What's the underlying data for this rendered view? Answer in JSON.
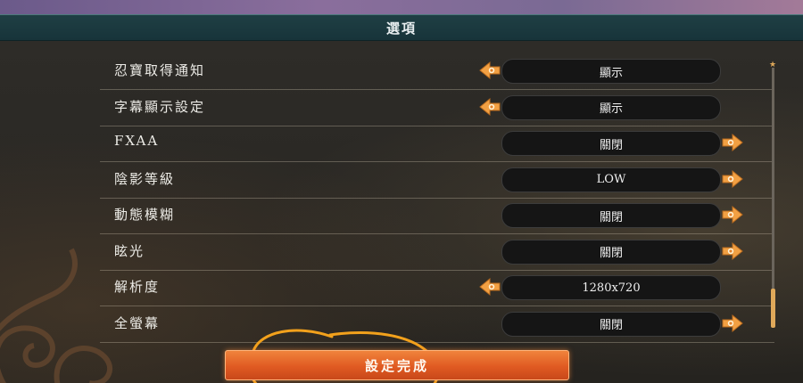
{
  "header": {
    "title": "選項"
  },
  "settings": [
    {
      "label": "忍寶取得通知",
      "value": "顯示",
      "arrow": "left"
    },
    {
      "label": "字幕顯示設定",
      "value": "顯示",
      "arrow": "left"
    },
    {
      "label": "FXAA",
      "value": "關閉",
      "arrow": "right"
    },
    {
      "label": "陰影等級",
      "value": "LOW",
      "arrow": "right"
    },
    {
      "label": "動態模糊",
      "value": "關閉",
      "arrow": "right"
    },
    {
      "label": "眩光",
      "value": "關閉",
      "arrow": "right"
    },
    {
      "label": "解析度",
      "value": "1280x720",
      "arrow": "left"
    },
    {
      "label": "全螢幕",
      "value": "關閉",
      "arrow": "right"
    }
  ],
  "footer": {
    "confirm_label": "設定完成"
  },
  "colors": {
    "accent": "#f07a30",
    "header": "#1f3f44",
    "arrow": "#f2a043"
  },
  "icons": {
    "prev": "orange-left-arrow-icon",
    "next": "orange-right-arrow-icon"
  }
}
